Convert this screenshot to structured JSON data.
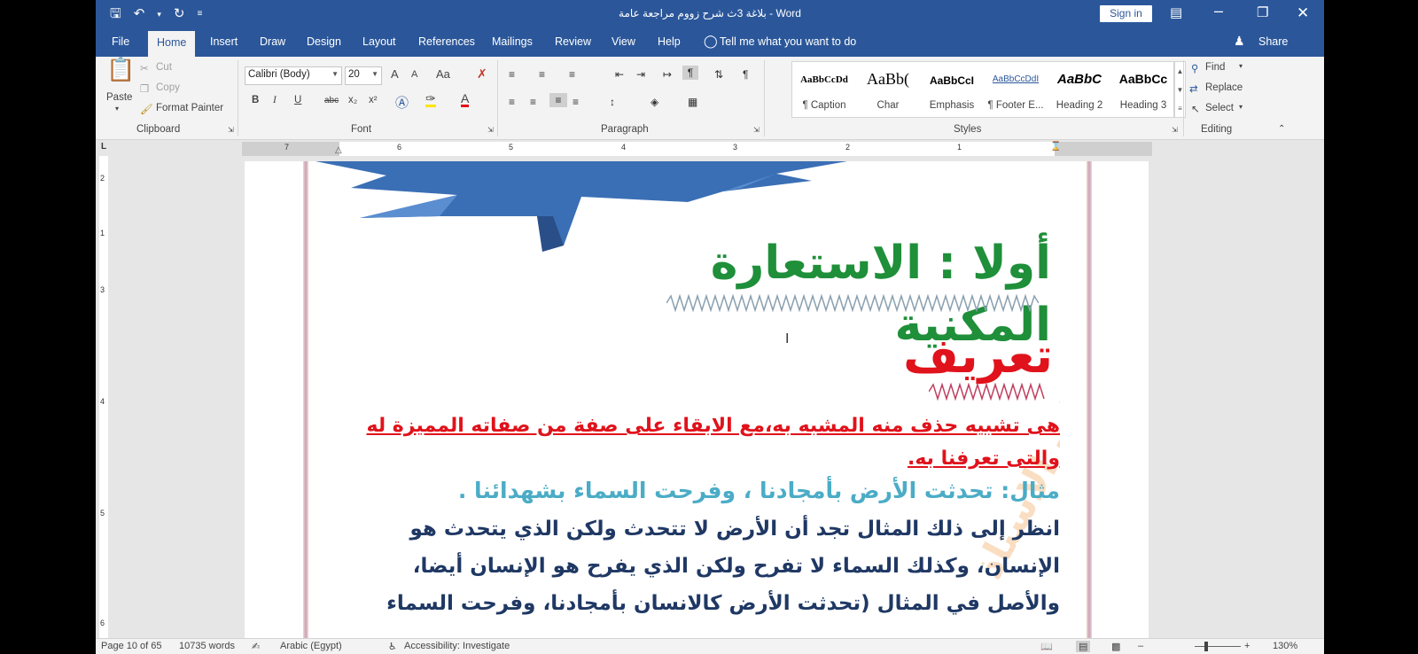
{
  "window": {
    "title": "بلاغة 3ث شرح زووم مراجعة عامة  -  Word",
    "sign_in": "Sign in"
  },
  "qat": {
    "save_icon": "save-icon",
    "undo_icon": "undo-icon",
    "redo_icon": "redo-icon",
    "customize_icon": "customize-qat-icon"
  },
  "tabs": [
    "File",
    "Home",
    "Insert",
    "Draw",
    "Design",
    "Layout",
    "References",
    "Mailings",
    "Review",
    "View",
    "Help"
  ],
  "active_tab": "Home",
  "tell_me": "Tell me what you want to do",
  "share": "Share",
  "clipboard": {
    "paste": "Paste",
    "cut": "Cut",
    "copy": "Copy",
    "format_painter": "Format Painter",
    "label": "Clipboard"
  },
  "font": {
    "name": "Calibri (Body)",
    "size": "20",
    "label": "Font",
    "grow": "A",
    "shrink": "A",
    "case": "Aa",
    "bold": "B",
    "italic": "I",
    "underline": "U",
    "strike": "abc",
    "sub": "x₂",
    "sup": "x²"
  },
  "paragraph": {
    "label": "Paragraph"
  },
  "styles": {
    "label": "Styles",
    "items": [
      {
        "preview": "AaBbCcDd",
        "name": "¶ Caption"
      },
      {
        "preview": "AaBb(",
        "name": "Char"
      },
      {
        "preview": "AaBbCcI",
        "name": "Emphasis"
      },
      {
        "preview": "AaBbCcDdI",
        "name": "¶ Footer E..."
      },
      {
        "preview": "AaBbC",
        "name": "Heading 2"
      },
      {
        "preview": "AaBbCc",
        "name": "Heading 3"
      }
    ]
  },
  "editing": {
    "find": "Find",
    "replace": "Replace",
    "select": "Select",
    "label": "Editing"
  },
  "ruler": {
    "h_numbers": [
      "7",
      "6",
      "5",
      "4",
      "3",
      "2",
      "1"
    ],
    "v_numbers": [
      "2",
      "1",
      "3",
      "4",
      "5",
      "6"
    ]
  },
  "document": {
    "heading1": "أولا : الاستعارة المكنية",
    "heading2": "تعريف",
    "definition": "هى تشبيه حذف منه المشبه به،مع الابقاء على صفة من صفاته المميزة له والتى تعرفنا به.",
    "example": "مثال: تحدثت الأرض بأمجادنا ، وفرحت السماء بشهدائنا .",
    "explanation": "انظر إلى ذلك المثال تجد أن الأرض لا تتحدث ولكن الذي يتحدث هو الإنسان، وكذلك السماء لا تفرح ولكن الذي يفرح هو الإنسان أيضا، والأصل في المثال (تحدثت الأرض كالانسان بأمجادنا، وفرحت السماء"
  },
  "status": {
    "page": "Page 10 of 65",
    "words": "10735 words",
    "language": "Arabic (Egypt)",
    "accessibility": "Accessibility: Investigate",
    "zoom": "130%",
    "zoom_level": 0.3
  }
}
